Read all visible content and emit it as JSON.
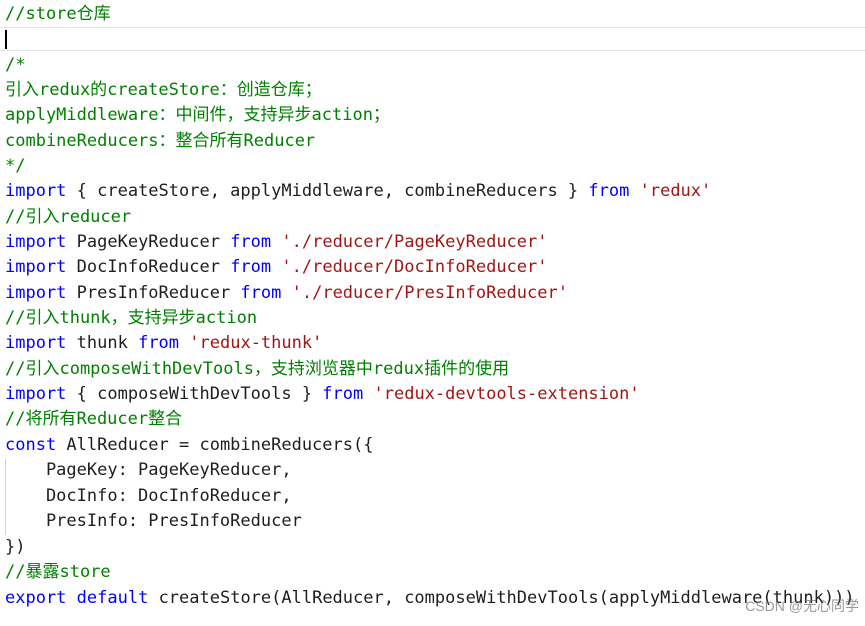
{
  "colors": {
    "comment": "#008000",
    "keyword": "#0000ff",
    "string": "#a31515",
    "plain": "#1e1e1e"
  },
  "code": {
    "l1": "//store仓库",
    "l3": "/*",
    "l4": "引入redux的createStore：创造仓库；",
    "l5": "applyMiddleware：中间件，支持异步action；",
    "l6": "combineReducers：整合所有Reducer",
    "l7": "*/",
    "l8": {
      "kw1": "import",
      "mid": " { createStore, applyMiddleware, combineReducers } ",
      "kw2": "from",
      "sp": " ",
      "str": "'redux'"
    },
    "l9": "//引入reducer",
    "l10": {
      "kw1": "import",
      "mid": " PageKeyReducer ",
      "kw2": "from",
      "sp": " ",
      "str": "'./reducer/PageKeyReducer'"
    },
    "l11": {
      "kw1": "import",
      "mid": " DocInfoReducer ",
      "kw2": "from",
      "sp": " ",
      "str": "'./reducer/DocInfoReducer'"
    },
    "l12": {
      "kw1": "import",
      "mid": " PresInfoReducer ",
      "kw2": "from",
      "sp": " ",
      "str": "'./reducer/PresInfoReducer'"
    },
    "l13": "//引入thunk，支持异步action",
    "l14": {
      "kw1": "import",
      "mid": " thunk ",
      "kw2": "from",
      "sp": " ",
      "str": "'redux-thunk'"
    },
    "l15": "//引入composeWithDevTools，支持浏览器中redux插件的使用",
    "l16": {
      "kw1": "import",
      "mid": " { composeWithDevTools } ",
      "kw2": "from",
      "sp": " ",
      "str": "'redux-devtools-extension'"
    },
    "l17": "//将所有Reducer整合",
    "l18": {
      "kw1": "const",
      "mid": " AllReducer = combineReducers({"
    },
    "l19": "    PageKey: PageKeyReducer,",
    "l20": "    DocInfo: DocInfoReducer,",
    "l21": "    PresInfo: PresInfoReducer",
    "l22": "})",
    "l23": "//暴露store",
    "l24": {
      "kw1": "export",
      "sp1": " ",
      "kw2": "default",
      "mid": " createStore(AllReducer, composeWithDevTools(applyMiddleware(thunk)))"
    }
  },
  "watermark": "CSDN @无心同学"
}
